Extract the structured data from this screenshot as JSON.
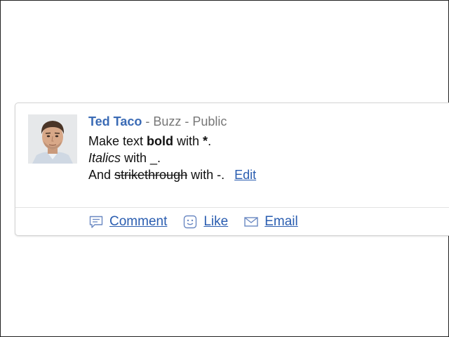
{
  "post": {
    "author": "Ted Taco",
    "separator1": " - ",
    "source": "Buzz",
    "separator2": " - ",
    "visibility": "Public",
    "line1": {
      "prefix": "Make text ",
      "bold": "bold",
      "mid": " with ",
      "marker": "*",
      "suffix": "."
    },
    "line2": {
      "italic": "Italics",
      "suffix": " with _."
    },
    "line3": {
      "prefix": "And ",
      "strike": "strikethrough",
      "suffix": " with -."
    },
    "edit_label": "Edit"
  },
  "actions": {
    "comment": {
      "label": "Comment",
      "icon": "comment-icon"
    },
    "like": {
      "label": "Like",
      "icon": "smiley-icon"
    },
    "email": {
      "label": "Email",
      "icon": "envelope-icon"
    }
  },
  "colors": {
    "author": "#3b6bb5",
    "link": "#2a5db0",
    "meta": "#777777"
  }
}
